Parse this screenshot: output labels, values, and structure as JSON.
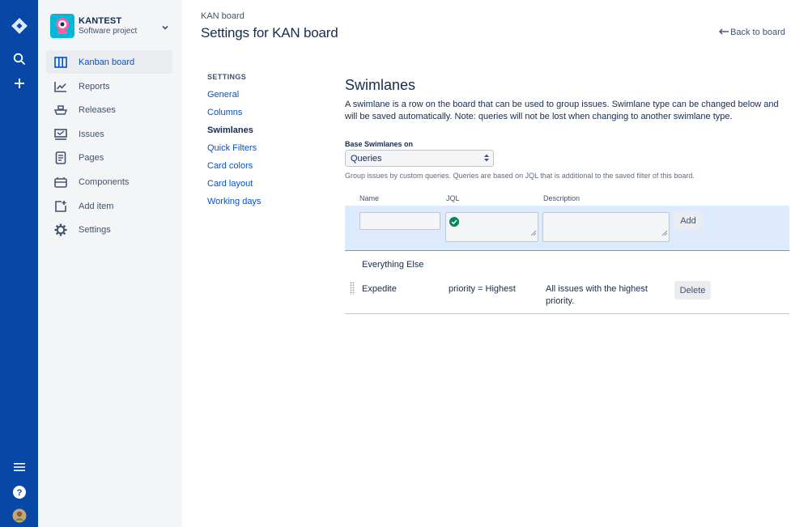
{
  "global_nav": {
    "icons": [
      "jira-logo-icon",
      "search-icon",
      "create-icon",
      "menu-icon",
      "help-icon",
      "user-avatar"
    ]
  },
  "project": {
    "name": "KANTEST",
    "type": "Software project"
  },
  "sidebar": {
    "items": [
      {
        "label": "Kanban board",
        "icon": "board-icon",
        "active": true
      },
      {
        "label": "Reports",
        "icon": "reports-icon"
      },
      {
        "label": "Releases",
        "icon": "ship-icon"
      },
      {
        "label": "Issues",
        "icon": "issues-icon"
      },
      {
        "label": "Pages",
        "icon": "page-icon"
      },
      {
        "label": "Components",
        "icon": "component-icon"
      },
      {
        "label": "Add item",
        "icon": "add-item-icon"
      },
      {
        "label": "Settings",
        "icon": "gear-icon"
      }
    ]
  },
  "header": {
    "breadcrumb": "KAN board",
    "title": "Settings for KAN board",
    "back_link": "Back to board"
  },
  "settings_nav": {
    "heading": "SETTINGS",
    "items": [
      "General",
      "Columns",
      "Swimlanes",
      "Quick Filters",
      "Card colors",
      "Card layout",
      "Working days"
    ],
    "current": "Swimlanes"
  },
  "swimlanes": {
    "title": "Swimlanes",
    "description": "A swimlane is a row on the board that can be used to group issues. Swimlane type can be changed below and will be saved automatically. Note: queries will not be lost when changing to another swimlane type.",
    "base_label": "Base Swimlanes on",
    "base_value": "Queries",
    "help_text": "Group issues by custom queries. Queries are based on JQL that is additional to the saved filter of this board.",
    "columns": {
      "name": "Name",
      "jql": "JQL",
      "description": "Description"
    },
    "add_button": "Add",
    "rows": [
      {
        "name": "Everything Else",
        "jql": "",
        "description": ""
      },
      {
        "name": "Expedite",
        "jql": "priority = Highest",
        "description": "All issues with the highest priority.",
        "delete": "Delete"
      }
    ]
  },
  "colors": {
    "nav_bg": "#0747A6",
    "sidebar_bg": "#F4F5F7",
    "link": "#0052CC",
    "add_row_bg": "#DEEBFF",
    "valid": "#00875A"
  }
}
